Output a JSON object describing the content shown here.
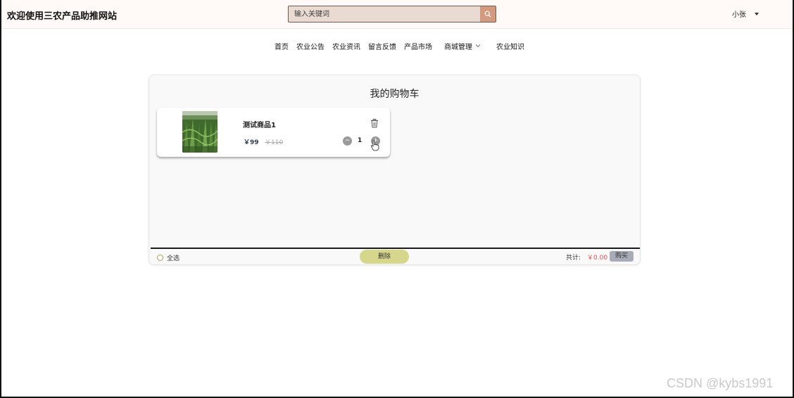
{
  "header": {
    "site_title": "欢迎使用三农产品助推网站",
    "search_placeholder": "输入关键词",
    "search_icon": "search-icon",
    "user_name": "小张"
  },
  "nav": {
    "items": [
      "首页",
      "农业公告",
      "农业资讯",
      "留言反馈",
      "产品市场"
    ],
    "dropdown_item": "商城管理",
    "last_item": "农业知识"
  },
  "cart": {
    "title": "我的购物车",
    "items": [
      {
        "name": "测试商品1",
        "price": "￥99",
        "old_price": "￥110",
        "quantity": "1",
        "selected": false
      }
    ],
    "footer": {
      "select_all_label": "全选",
      "delete_label": "删除",
      "total_label": "共计:",
      "total_value": "￥0.00",
      "buy_label": "购买"
    }
  },
  "colors": {
    "header_bg": "#fffaf7",
    "search_bg": "#eadbd2",
    "search_button": "#d39a80",
    "delete_button": "#d6d68c",
    "buy_button": "#a8acb8",
    "total_price": "#e84b4b",
    "radio_border": "#b49a55"
  },
  "watermark": "CSDN @kybs1991"
}
